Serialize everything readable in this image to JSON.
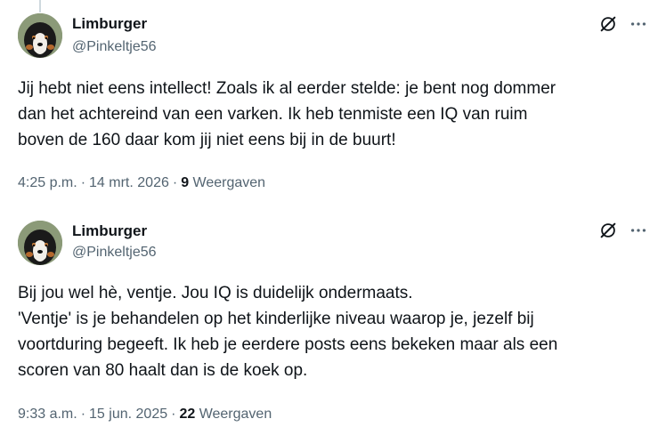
{
  "tweets": [
    {
      "author": {
        "name": "Limburger",
        "handle": "@Pinkeltje56",
        "avatar_icon": "dog-avatar"
      },
      "text": "Jij hebt niet eens intellect! Zoals ik al eerder stelde: je bent nog dommer\ndan het achtereind van een varken. Ik heb tenmiste een IQ van ruim\nboven de 160 daar kom jij niet eens bij in de buurt!",
      "time": "4:25 p.m.",
      "date": "14 mrt. 2026",
      "views_count": "9",
      "views_label": "Weergaven"
    },
    {
      "author": {
        "name": "Limburger",
        "handle": "@Pinkeltje56",
        "avatar_icon": "dog-avatar"
      },
      "text": "Bij jou wel hè, ventje. Jou IQ is duidelijk ondermaats.\n'Ventje' is je behandelen op het kinderlijke niveau waarop je, jezelf bij\nvoortduring begeeft. Ik heb je eerdere posts eens bekeken maar als een\nscoren van 80 haalt dan is de koek op.",
      "time": "9:33 a.m.",
      "date": "15 jun. 2025",
      "views_count": "22",
      "views_label": "Weergaven"
    }
  ],
  "icons": {
    "grok": "grok-icon",
    "more": "more-options-icon"
  },
  "colors": {
    "text": "#0f1419",
    "secondary": "#536471",
    "thread_line": "#cfd9de"
  }
}
